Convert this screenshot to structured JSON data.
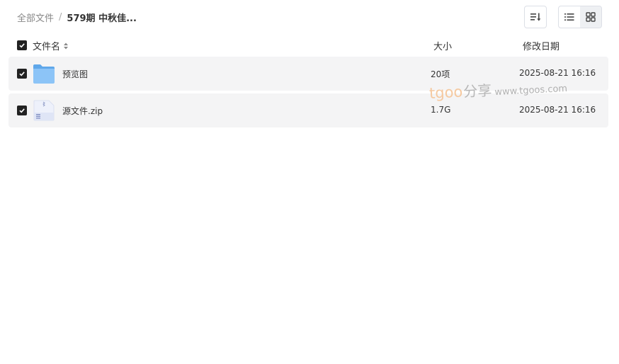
{
  "breadcrumb": {
    "root": "全部文件",
    "separator": "/",
    "current": "579期 中秋佳..."
  },
  "toolbar": {
    "sort_icon": "sort-list-icon",
    "list_view_icon": "list-view-icon",
    "grid_view_icon": "grid-view-icon"
  },
  "table": {
    "columns": {
      "name": "文件名",
      "size": "大小",
      "date": "修改日期"
    },
    "rows": [
      {
        "name": "预览图",
        "size": "20项",
        "date": "2025-08-21 16:16",
        "icon": "folder-icon",
        "checked": true
      },
      {
        "name": "源文件.zip",
        "size": "1.7G",
        "date": "2025-08-21 16:16",
        "icon": "zip-file-icon",
        "checked": true
      }
    ]
  },
  "watermark": {
    "brand": "tgoo",
    "share": "分享",
    "url": "www.tgoos.com"
  },
  "colors": {
    "row_bg": "#f4f4f5",
    "checkbox": "#222222",
    "folder": "#79b8f3",
    "watermark_brand": "#f5c9a0"
  }
}
